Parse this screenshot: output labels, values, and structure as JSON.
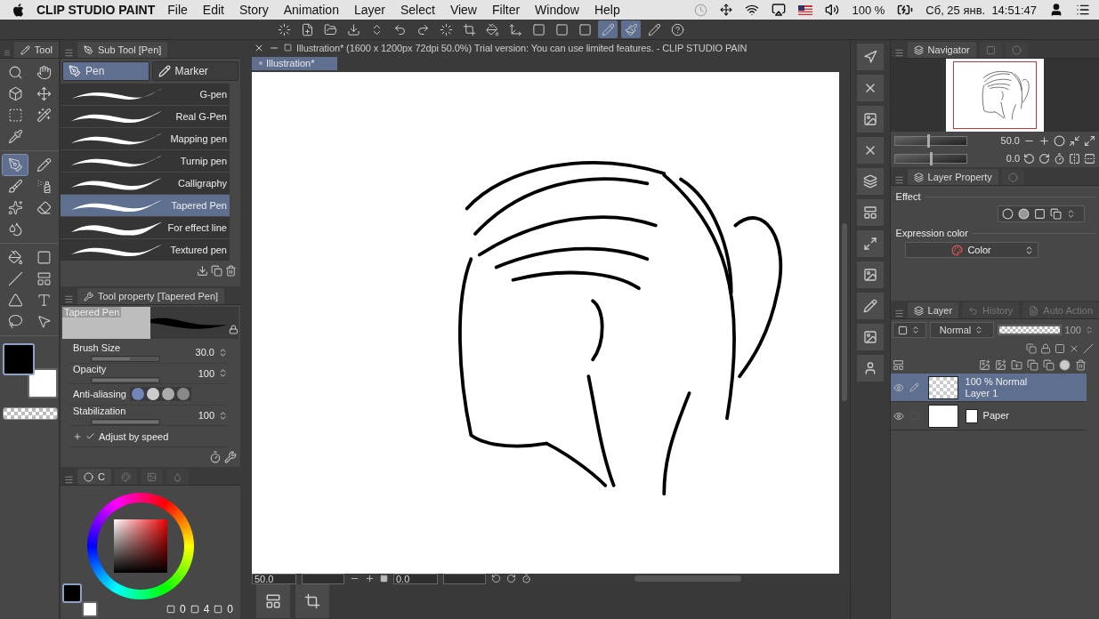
{
  "menubar": {
    "app": "CLIP STUDIO PAINT",
    "menus": [
      "File",
      "Edit",
      "Story",
      "Animation",
      "Layer",
      "Select",
      "View",
      "Filter",
      "Window",
      "Help"
    ],
    "battery": "100 %",
    "datetime": "Сб, 25 янв.  14:51:47"
  },
  "tool_palette": {
    "title": "Tool",
    "tools": [
      {
        "selected": false
      },
      {
        "selected": false
      },
      {
        "selected": false
      },
      {
        "selected": false
      },
      {
        "selected": false
      },
      {
        "selected": false
      },
      {
        "selected": false
      },
      {
        "selected": true
      },
      {
        "selected": false
      },
      {
        "selected": false
      },
      {
        "selected": false
      },
      {
        "selected": false
      },
      {
        "selected": false
      },
      {
        "selected": false
      },
      {
        "selected": false
      },
      {
        "selected": false
      },
      {
        "selected": false
      },
      {
        "selected": false
      },
      {
        "selected": false
      },
      {
        "selected": false
      },
      {
        "selected": false
      },
      {
        "selected": false
      }
    ]
  },
  "sub_tool": {
    "title": "Sub Tool [Pen]",
    "groups": [
      {
        "label": "Pen",
        "selected": true
      },
      {
        "label": "Marker",
        "selected": false
      }
    ],
    "items": [
      {
        "label": "G-pen",
        "selected": false
      },
      {
        "label": "Real G-Pen",
        "selected": false
      },
      {
        "label": "Mapping pen",
        "selected": false
      },
      {
        "label": "Turnip pen",
        "selected": false
      },
      {
        "label": "Calligraphy",
        "selected": false
      },
      {
        "label": "Tapered Pen",
        "selected": true
      },
      {
        "label": "For effect line",
        "selected": false
      },
      {
        "label": "Textured pen",
        "selected": false
      }
    ]
  },
  "tool_property": {
    "title": "Tool property [Tapered Pen]",
    "preview_label": "Tapered Pen",
    "properties": [
      {
        "kind": "slider",
        "label": "Brush Size",
        "value": "30.0",
        "level": 0.57
      },
      {
        "kind": "slider",
        "label": "Opacity",
        "value": "100",
        "level": 1
      },
      {
        "kind": "choice",
        "label": "Anti-aliasing"
      },
      {
        "kind": "slider",
        "label": "Stabilization",
        "value": "100",
        "level": 1
      },
      {
        "kind": "check",
        "label": "Adjust by speed",
        "checked": true
      }
    ]
  },
  "color_panel": {
    "tab": "C",
    "counters": [
      "0",
      "4",
      "0"
    ]
  },
  "document": {
    "title": "Illustration* (1600 x 1200px 72dpi 50.0%)  Trial version: You can use limited features. - CLIP STUDIO PAIN",
    "tab": "Illustration*",
    "zoom": "50.0",
    "rotation": "0.0"
  },
  "navigator": {
    "title": "Navigator",
    "sliders": [
      {
        "kind": "zoom",
        "value": "50.0",
        "level": 0.47
      },
      {
        "kind": "rotation",
        "value": "0.0",
        "level": 0.5
      }
    ]
  },
  "layer_property": {
    "title": "Layer Property",
    "effect_label": "Effect",
    "expression_label": "Expression color",
    "expression_value": "Color"
  },
  "layer_panel": {
    "tabs": [
      {
        "label": "Layer",
        "selected": true
      },
      {
        "label": "History",
        "selected": false
      },
      {
        "label": "Auto Action",
        "selected": false
      }
    ],
    "blend_mode": "Normal",
    "opacity": "100",
    "level": 1,
    "layers": [
      {
        "kind": "raster",
        "mode": "100 % Normal",
        "name": "Layer 1",
        "selected": true
      },
      {
        "kind": "paper",
        "name": "Paper",
        "selected": false
      }
    ]
  }
}
